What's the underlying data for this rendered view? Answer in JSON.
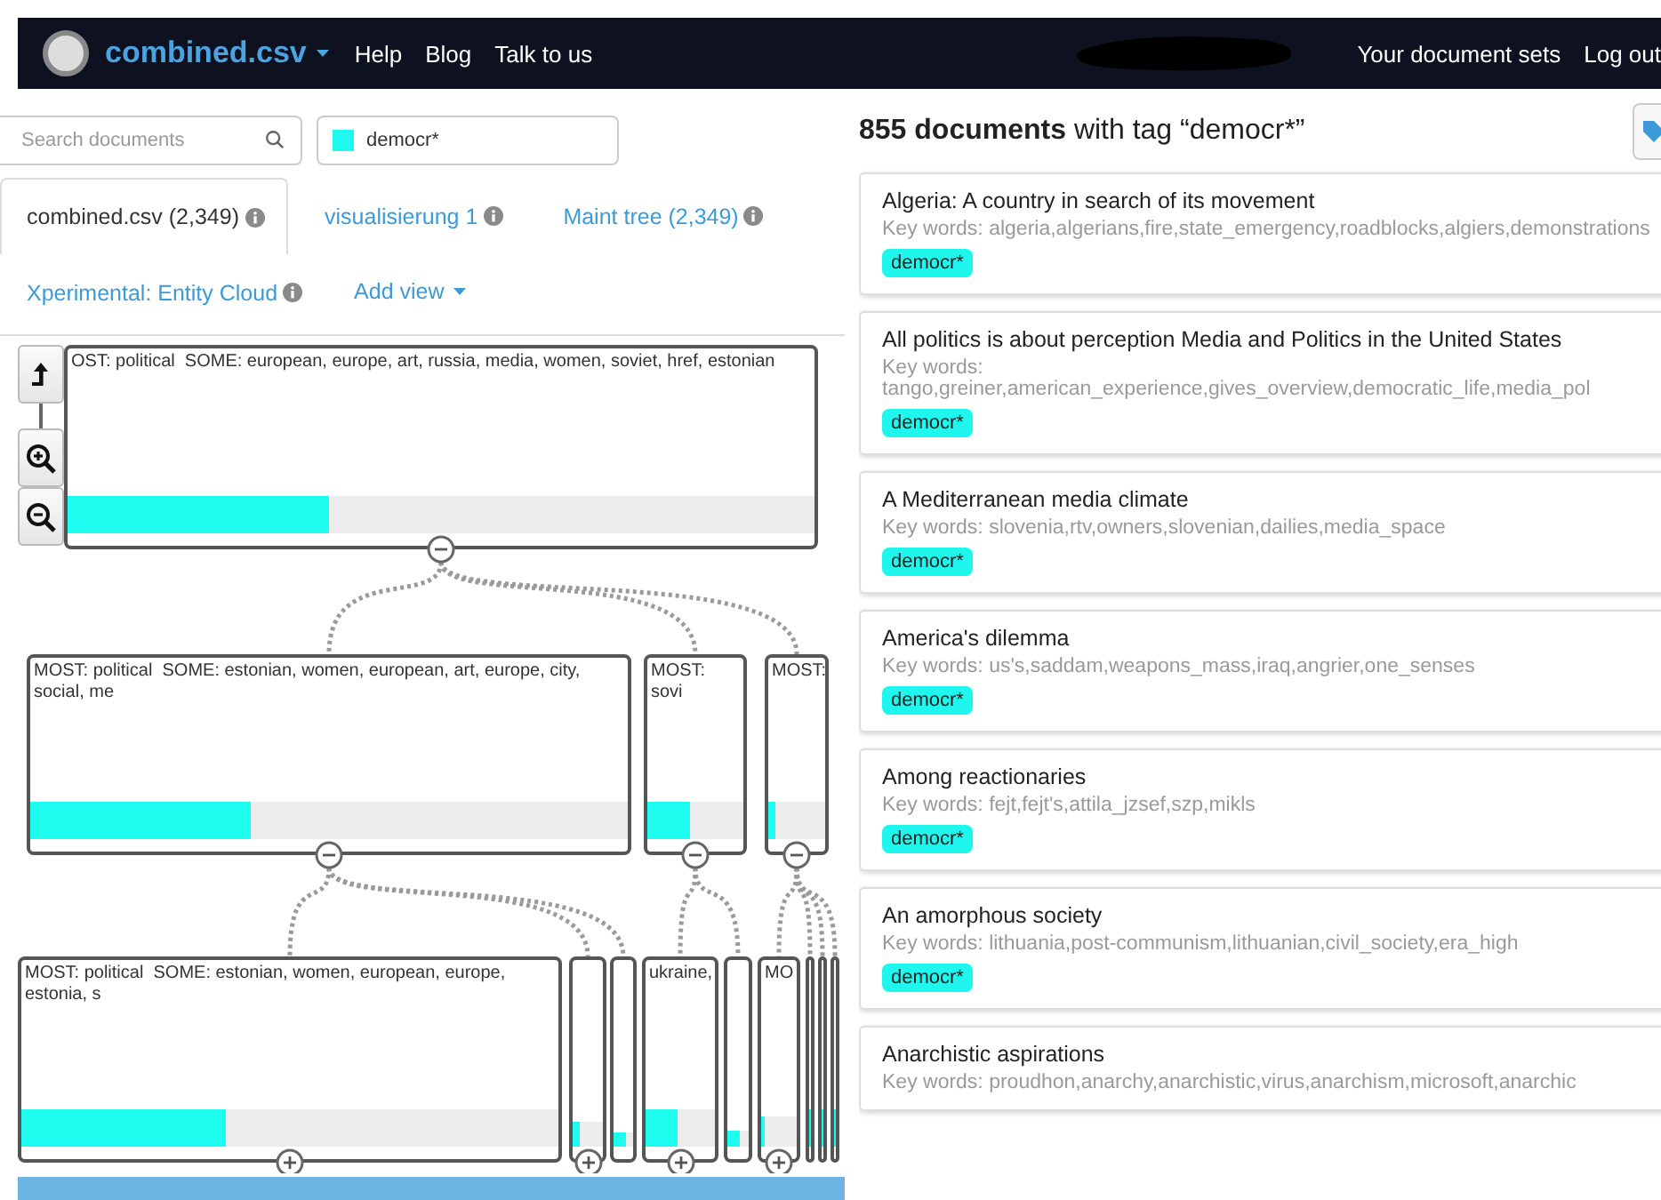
{
  "nav": {
    "project": "combined.csv",
    "links": [
      "Help",
      "Blog",
      "Talk to us"
    ],
    "right_links": [
      "Your document sets",
      "Log out"
    ]
  },
  "search": {
    "placeholder": "Search documents"
  },
  "tag_filter": {
    "value": "democr*"
  },
  "views": [
    {
      "label": "combined.csv (2,349)",
      "selected": true,
      "info": true
    },
    {
      "label": "visualisierung 1",
      "selected": false,
      "info": true
    },
    {
      "label": "Maint tree (2,349)",
      "selected": false,
      "info": true
    },
    {
      "label": "Xperimental: Entity Cloud",
      "selected": false,
      "info": true
    }
  ],
  "add_view": {
    "label": "Add view"
  },
  "tree": {
    "label": "OST: political  SOME: european, europe, art, russia, media, women, soviet, href, estonian",
    "level": 0.35,
    "expanded": true,
    "children": [
      {
        "label": "MOST: political  SOME: estonian, women, european, art, europe, city, social, me",
        "level": 0.37,
        "expanded": true,
        "children": [
          {
            "label": "MOST: political  SOME: estonian, women, european, europe, estonia, s",
            "level": 0.38,
            "expanded": false
          },
          {
            "level": 0.25,
            "expanded": false
          },
          {
            "level": 0.6
          }
        ]
      },
      {
        "label": "MOST: sovi",
        "level": 0.45,
        "expanded": true,
        "children": [
          {
            "label": "ukraine,",
            "level": 0.45,
            "expanded": false
          },
          {
            "level": 0.6
          }
        ]
      },
      {
        "label": "MOST:",
        "level": 0.12,
        "expanded": true,
        "children": [
          {
            "label": "MO",
            "level": 0.1,
            "expanded": false
          },
          {
            "level": 1
          },
          {
            "level": 1
          },
          {
            "level": 1
          }
        ]
      }
    ]
  },
  "results": {
    "count": "855 documents",
    "text": "with tag “democr*”",
    "documents": [
      {
        "title": "Algeria: A country in search of its movement",
        "keywords": "Key words: algeria,algerians,fire,state_emergency,roadblocks,algiers,demonstrations",
        "tags": [
          "democr*"
        ]
      },
      {
        "title": "All politics is about perception Media and Politics in the United States",
        "keywords": "Key words: tango,greiner,american_experience,gives_overview,democratic_life,media_pol",
        "tags": [
          "democr*"
        ]
      },
      {
        "title": "A Mediterranean media climate",
        "keywords": "Key words: slovenia,rtv,owners,slovenian,dailies,media_space",
        "tags": [
          "democr*"
        ]
      },
      {
        "title": "America's dilemma",
        "keywords": "Key words: us's,saddam,weapons_mass,iraq,angrier,one_senses",
        "tags": [
          "democr*"
        ]
      },
      {
        "title": "Among reactionaries",
        "keywords": "Key words: fejt,fejt's,attila_jzsef,szp,mikls",
        "tags": [
          "democr*"
        ]
      },
      {
        "title": "An amorphous society",
        "keywords": "Key words: lithuania,post-communism,lithuanian,civil_society,era_high",
        "tags": [
          "democr*"
        ]
      },
      {
        "title": "Anarchistic aspirations",
        "keywords": "Key words: proudhon,anarchy,anarchistic,virus,anarchism,microsoft,anarchic"
      }
    ]
  }
}
